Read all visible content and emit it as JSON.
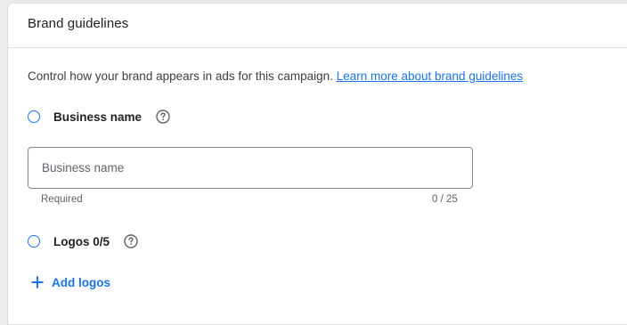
{
  "card": {
    "title": "Brand guidelines",
    "description_text": "Control how your brand appears in ads for this campaign.",
    "learn_more_link": "Learn more about brand guidelines"
  },
  "business_name_option": {
    "label": "Business name",
    "selected": false,
    "input_placeholder": "Business name",
    "input_value": "",
    "helper_text": "Required",
    "char_count": "0 / 25"
  },
  "logos_option": {
    "label": "Logos 0/5",
    "selected": false
  },
  "add_logos_button": {
    "label": "Add logos"
  },
  "icons": {
    "help": "help-circle-icon",
    "add": "plus-icon"
  },
  "colors": {
    "accent": "#1a73e8",
    "border": "#80868b",
    "text_primary": "#202124",
    "text_secondary": "#5f6368"
  }
}
